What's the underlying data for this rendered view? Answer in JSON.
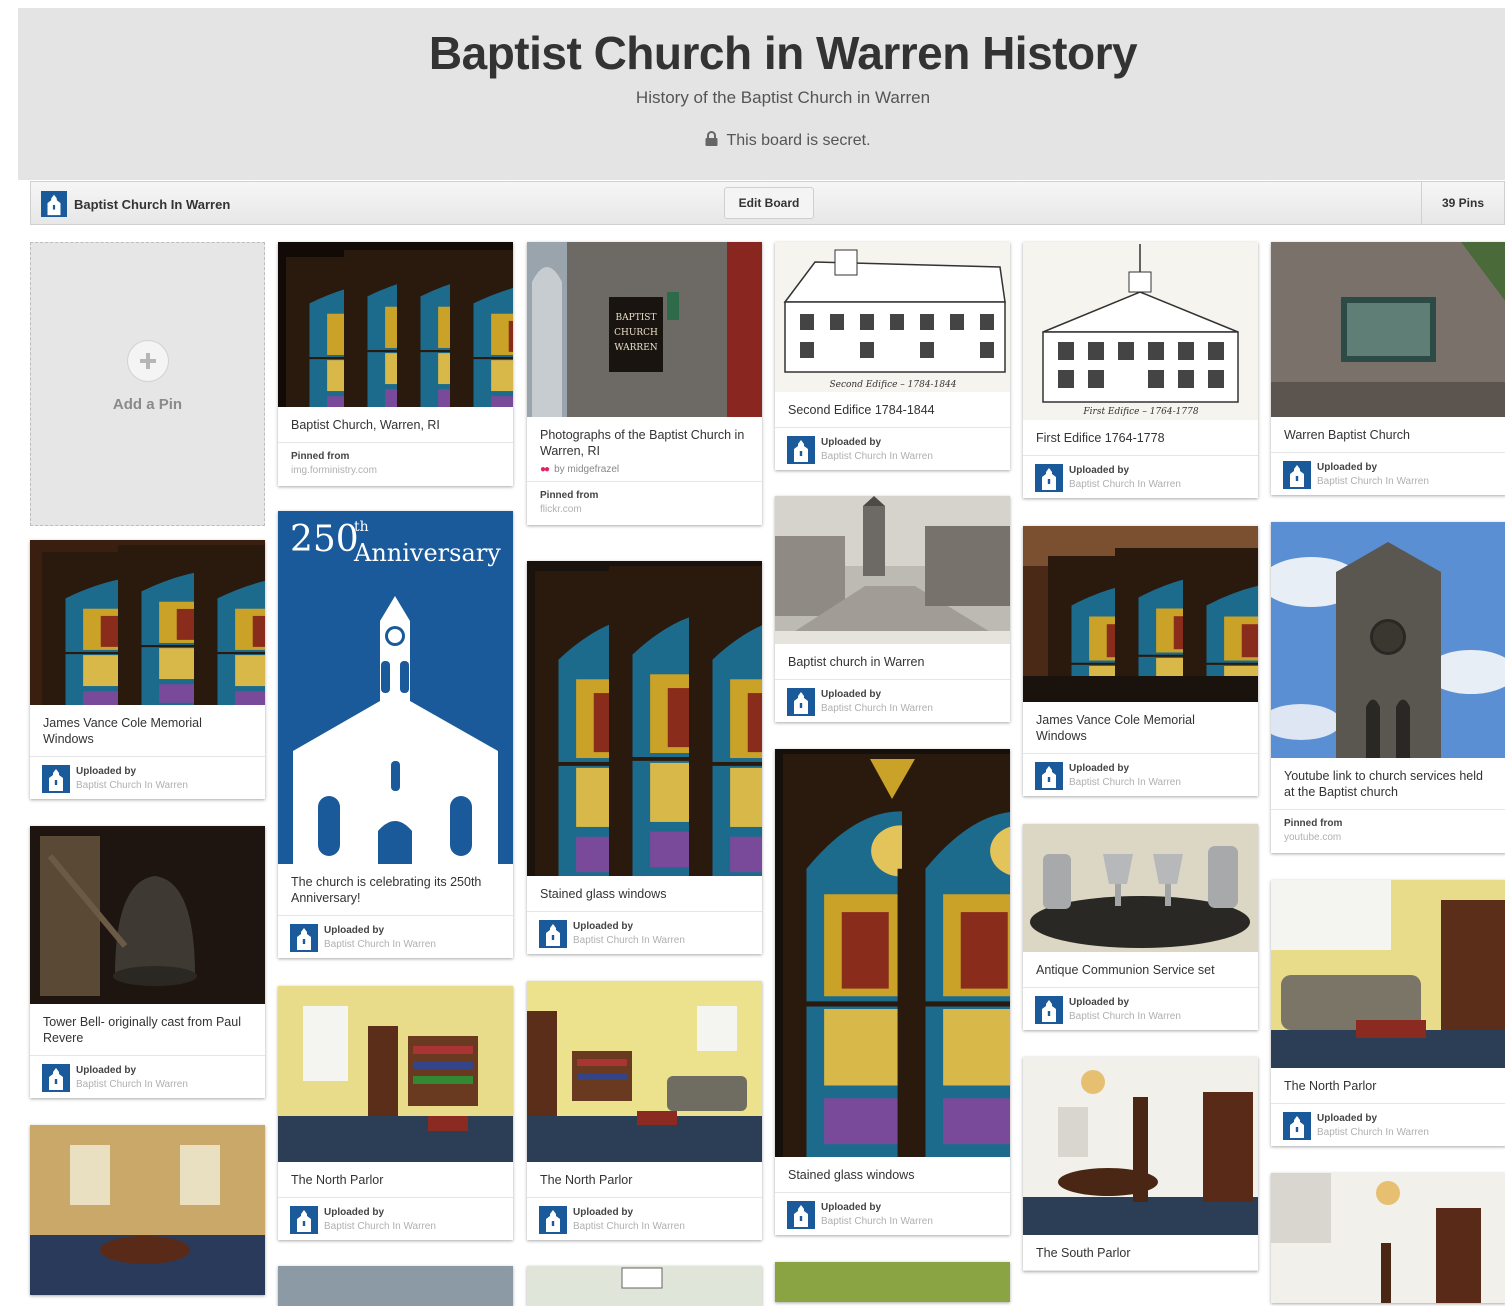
{
  "board": {
    "title": "Baptist Church in Warren History",
    "description": "History of the Baptist Church in Warren",
    "secret_notice": "This board is secret."
  },
  "toolbar": {
    "owner_name": "Baptist Church In Warren",
    "edit_label": "Edit Board",
    "pin_count": "39 Pins"
  },
  "add_pin": {
    "label": "Add a Pin"
  },
  "credit": {
    "uploaded_by": "Uploaded by",
    "pinned_from": "Pinned from",
    "owner": "Baptist Church In Warren"
  },
  "pins": {
    "p1": {
      "desc": "James Vance Cole Memorial Windows"
    },
    "p2": {
      "desc": "Tower Bell- originally cast from Paul Revere"
    },
    "p3": {
      "desc": "Baptist Church, Warren, RI",
      "source": "img.forministry.com"
    },
    "p4": {
      "desc": "The church is celebrating its 250th Anniversary!",
      "poster_number": "250",
      "poster_suffix": "th",
      "poster_word": "Anniversary"
    },
    "p5": {
      "desc": "The North Parlor"
    },
    "p6": {
      "desc": "Photographs of the Baptist Church in Warren, RI",
      "by": "by midgefrazel",
      "source": "flickr.com",
      "sign": [
        "BAPTIST",
        "CHURCH",
        "WARREN"
      ]
    },
    "p7": {
      "desc": "Stained glass windows"
    },
    "p8": {
      "desc": "The North Parlor"
    },
    "p9": {
      "desc": "Second Edifice 1784-1844",
      "caption": "Second Edifice – 1784-1844"
    },
    "p10": {
      "desc": "Baptist church in Warren"
    },
    "p11": {
      "desc": "Stained glass windows"
    },
    "p12": {
      "desc": "First Edifice 1764-1778",
      "caption": "First Edifice – 1764-1778"
    },
    "p13": {
      "desc": "James Vance Cole Memorial Windows"
    },
    "p14": {
      "desc": "Antique Communion Service set"
    },
    "p15": {
      "desc": "The South Parlor"
    },
    "p16": {
      "desc": "Warren Baptist Church"
    },
    "p17": {
      "desc": "Youtube link to church services held at the Baptist church",
      "source": "youtube.com"
    },
    "p18": {
      "desc": "The North Parlor"
    }
  },
  "colors": {
    "brand_blue": "#1a5a9a",
    "board_bg": "#e4e4e4",
    "text": "#333333"
  }
}
